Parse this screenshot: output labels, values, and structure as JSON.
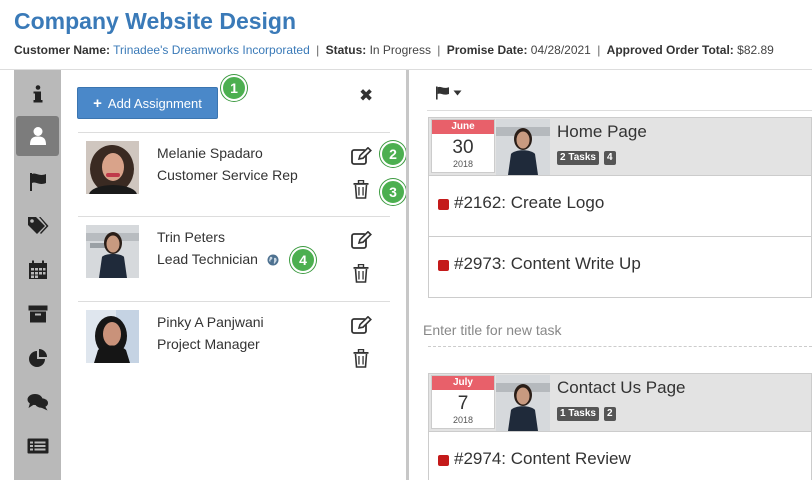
{
  "header": {
    "title": "Company Website Design",
    "customer_label": "Customer Name:",
    "customer_value": "Trinadee's Dreamworks Incorporated",
    "status_label": "Status:",
    "status_value": "In Progress",
    "promise_label": "Promise Date:",
    "promise_value": "04/28/2021",
    "total_label": "Approved Order Total:",
    "total_value": "$82.89",
    "separator": "|"
  },
  "sidebar": {
    "items": [
      {
        "icon": "info-icon"
      },
      {
        "icon": "user-icon",
        "active": true
      },
      {
        "icon": "flag-icon"
      },
      {
        "icon": "tags-icon"
      },
      {
        "icon": "calendar-icon"
      },
      {
        "icon": "archive-icon"
      },
      {
        "icon": "pie-chart-icon"
      },
      {
        "icon": "comments-icon"
      },
      {
        "icon": "list-icon"
      }
    ]
  },
  "assignments": {
    "add_label": "Add Assignment",
    "close_glyph": "✖",
    "people": [
      {
        "name": "Melanie Spadaro",
        "role": "Customer Service Rep",
        "avatar": "woman-curly-hair-avatar"
      },
      {
        "name": "Trin Peters",
        "role": "Lead Technician",
        "avatar": "woman-dark-shirt-avatar",
        "globe": true
      },
      {
        "name": "Pinky A Panjwani",
        "role": "Project Manager",
        "avatar": "woman-black-hair-avatar"
      }
    ]
  },
  "callouts": [
    "1",
    "2",
    "3",
    "4"
  ],
  "board": {
    "groups": [
      {
        "month": "June",
        "day": "30",
        "year": "2018",
        "title": "Home Page",
        "tasks_badge": "2 Tasks",
        "count_badge": "4",
        "tasks": [
          {
            "label": "#2162: Create Logo"
          },
          {
            "label": "#2973: Content Write Up"
          }
        ]
      },
      {
        "month": "July",
        "day": "7",
        "year": "2018",
        "title": "Contact Us Page",
        "tasks_badge": "1 Tasks",
        "count_badge": "2",
        "tasks": [
          {
            "label": "#2974: Content Review"
          }
        ]
      }
    ],
    "new_task_placeholder": "Enter title for new task"
  },
  "colors": {
    "title": "#3a7ab8",
    "button": "#4a88c9",
    "callout": "#4caf50",
    "priority": "#c41a1a",
    "calendar_month": "#e8606a"
  }
}
